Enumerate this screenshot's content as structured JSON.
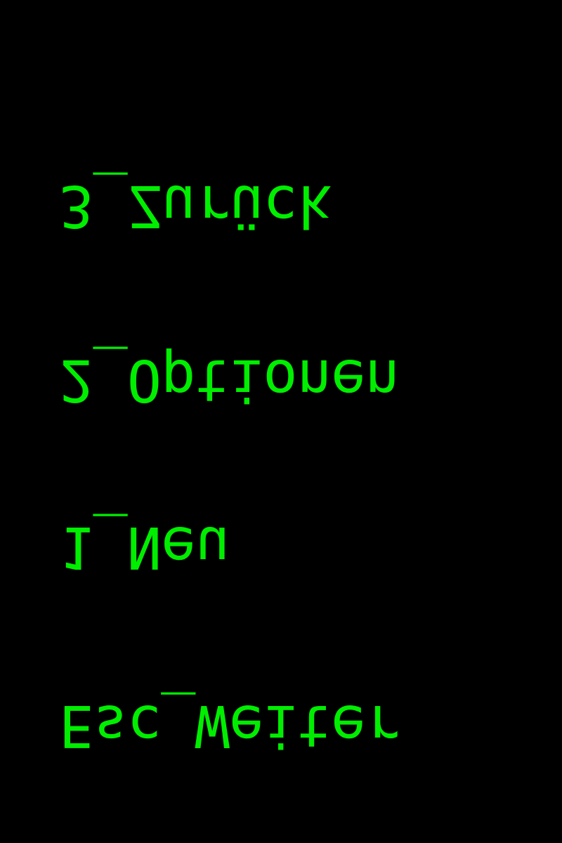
{
  "menu": {
    "items": [
      {
        "key": "Esc",
        "label": "Weiter"
      },
      {
        "key": "1",
        "label": "Neu"
      },
      {
        "key": "2",
        "label": "Optionen"
      },
      {
        "key": "3",
        "label": "Zurück"
      }
    ]
  },
  "colors": {
    "background": "#000000",
    "text": "#00ee00"
  }
}
